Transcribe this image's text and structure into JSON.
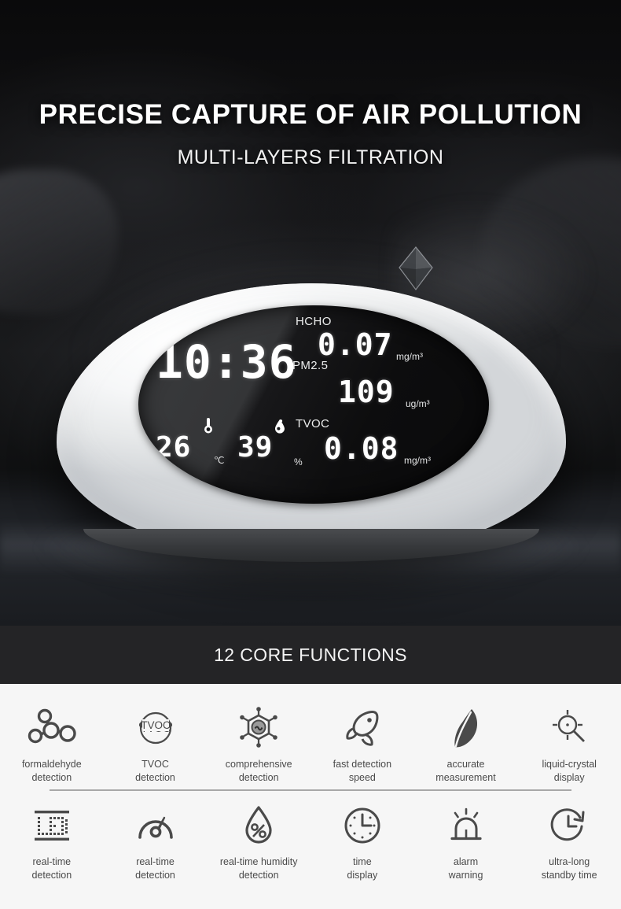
{
  "hero": {
    "headline": "PRECISE CAPTURE OF AIR POLLUTION",
    "subheadline": "MULTI-LAYERS FILTRATION",
    "crystal_icon": "diamond-crystal-icon"
  },
  "device": {
    "lcd": {
      "pm_label": "PM",
      "time": "10:36",
      "hcho_label": "HCHO",
      "hcho_value": "0.07",
      "hcho_unit": "mg/m³",
      "pm25_label": "PM2.5",
      "pm25_value": "109",
      "pm25_unit": "ug/m³",
      "temp_value": "26",
      "temp_unit": "℃",
      "temp_icon": "thermometer-icon",
      "humidity_value": "39",
      "humidity_unit": "%",
      "humidity_icon": "water-drop-icon",
      "tvoc_label": "TVOC",
      "tvoc_value": "0.08",
      "tvoc_unit": "mg/m³"
    }
  },
  "banner": {
    "title": "12 CORE FUNCTIONS"
  },
  "features": {
    "row1": [
      {
        "icon": "formaldehyde-molecule-icon",
        "line1": "formaldehyde",
        "line2": "detection"
      },
      {
        "icon": "tvoc-orbit-icon",
        "line1": "TVOC",
        "line2": "detection"
      },
      {
        "icon": "comprehensive-molecule-icon",
        "line1": "comprehensive",
        "line2": "detection"
      },
      {
        "icon": "rocket-icon",
        "line1": "fast detection",
        "line2": "speed"
      },
      {
        "icon": "leaf-icon",
        "line1": "accurate",
        "line2": "measurement"
      },
      {
        "icon": "magnifier-rays-icon",
        "line1": "liquid-crystal",
        "line2": "display"
      }
    ],
    "row2": [
      {
        "icon": "led-matrix-icon",
        "line1": "real-time",
        "line2": "detection"
      },
      {
        "icon": "gauge-icon",
        "line1": "real-time",
        "line2": "detection"
      },
      {
        "icon": "humidity-drop-percent-icon",
        "line1": "real-time humidity",
        "line2": "detection"
      },
      {
        "icon": "clock-icon",
        "line1": "time",
        "line2": "display"
      },
      {
        "icon": "alarm-beacon-icon",
        "line1": "alarm",
        "line2": "warning"
      },
      {
        "icon": "clock-arrow-icon",
        "line1": "ultra-long",
        "line2": "standby time"
      }
    ]
  },
  "colors": {
    "hero_bg": "#131315",
    "banner_bg": "#242426",
    "features_bg": "#f6f6f6",
    "icon_stroke": "#4a4a4a",
    "divider": "#a8a8a8",
    "lcd_text": "#ffffff"
  }
}
